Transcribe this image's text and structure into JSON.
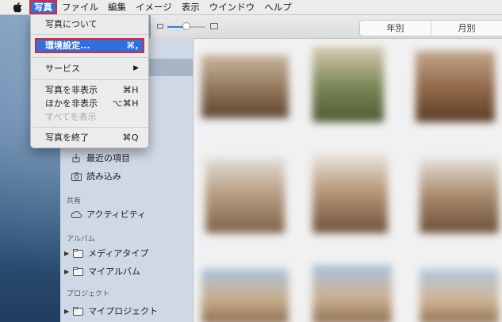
{
  "menubar": {
    "items": [
      "写真",
      "ファイル",
      "編集",
      "イメージ",
      "表示",
      "ウインドウ",
      "ヘルプ"
    ],
    "active_index": 0
  },
  "app_menu": {
    "about": "写真について",
    "preferences": {
      "label": "環境設定...",
      "shortcut": "⌘,"
    },
    "services": {
      "label": "サービス",
      "arrow": "▶"
    },
    "hide": {
      "label": "写真を非表示",
      "shortcut": "⌘H"
    },
    "hide_others": {
      "label": "ほかを非表示",
      "shortcut": "⌥⌘H"
    },
    "show_all": {
      "label": "すべてを表示"
    },
    "quit": {
      "label": "写真を終了",
      "shortcut": "⌘Q"
    }
  },
  "toolbar": {
    "zoom_level": 0.5,
    "segments": [
      "年別",
      "月別"
    ]
  },
  "sidebar": {
    "library_items": [
      {
        "label": "最近の項目",
        "icon": "recent-icon"
      },
      {
        "label": "読み込み",
        "icon": "import-icon"
      }
    ],
    "shared_header": "共有",
    "shared_items": [
      {
        "label": "アクティビティ",
        "icon": "cloud-icon"
      }
    ],
    "albums_header": "アルバム",
    "album_items": [
      {
        "label": "メディアタイプ",
        "icon": "folder-icon"
      },
      {
        "label": "マイアルバム",
        "icon": "folder-icon"
      }
    ],
    "projects_header": "プロジェクト",
    "project_items": [
      {
        "label": "マイプロジェクト",
        "icon": "folder-icon"
      }
    ]
  },
  "colors": {
    "menu_highlight": "#2f6fe0",
    "annotation_outline": "#e0262f",
    "sidebar_bg": "#cfd8e5"
  }
}
